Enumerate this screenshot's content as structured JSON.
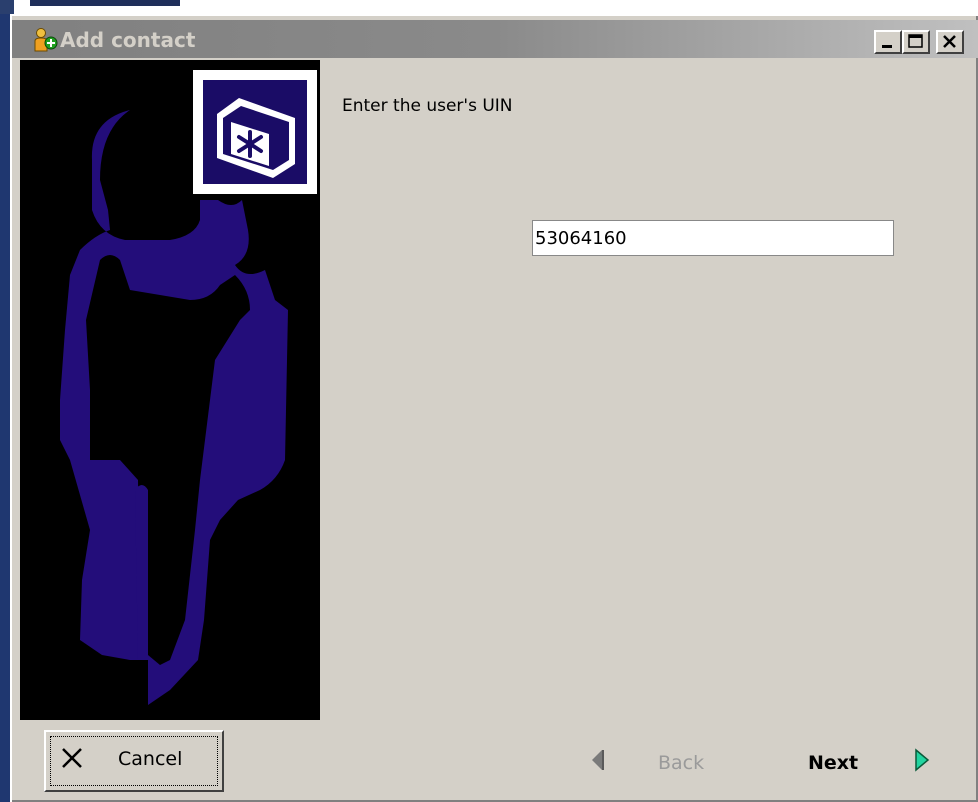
{
  "window": {
    "title": "Add contact",
    "icon": "add-user-icon",
    "controls": [
      "minimize",
      "maximize",
      "close"
    ]
  },
  "wizard": {
    "prompt": "Enter the user's UIN",
    "uin_value": "53064160"
  },
  "buttons": {
    "cancel_label": "Cancel",
    "back_label": "Back",
    "next_label": "Next"
  },
  "colors": {
    "face": "#d4d0c8",
    "sidebar_bg": "#000000",
    "figure": "#230d7a",
    "next_arrow": "#22d4a0",
    "disabled_text": "#9a9a9a"
  }
}
